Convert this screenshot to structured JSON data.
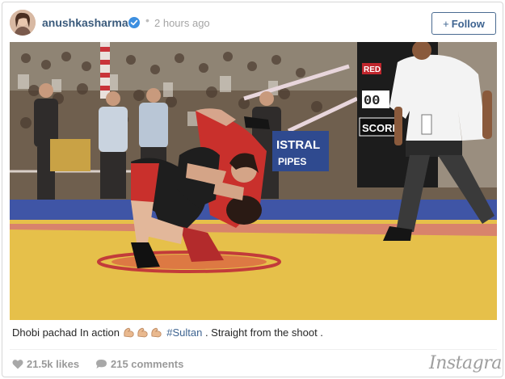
{
  "post": {
    "username": "anushkasharma",
    "verified_icon": "verified-check-icon",
    "separator": "•",
    "time": "2 hours ago",
    "follow_label": "Follow",
    "follow_icon": "+",
    "caption_text": "Dhobi pachad In action",
    "caption_emojis": [
      "flexed-biceps",
      "flexed-biceps",
      "flexed-biceps"
    ],
    "caption_hashtag": "#Sultan",
    "caption_rest": ". Straight from the shoot .",
    "likes": "21.5k likes",
    "comments": "215 comments",
    "brand": "Instagram"
  },
  "photo": {
    "scoreboard_red": "RED",
    "scoreboard_digits": "00",
    "scoreboard_score": "SCORE",
    "banner_text_1": "ISTRAL",
    "banner_text_2": "PIPES"
  },
  "colors": {
    "username": "#3b5b7c",
    "link": "#3e6491",
    "verified": "#3d8fe0",
    "mat_yellow": "#e8c24a",
    "mat_red": "#c8342e"
  }
}
